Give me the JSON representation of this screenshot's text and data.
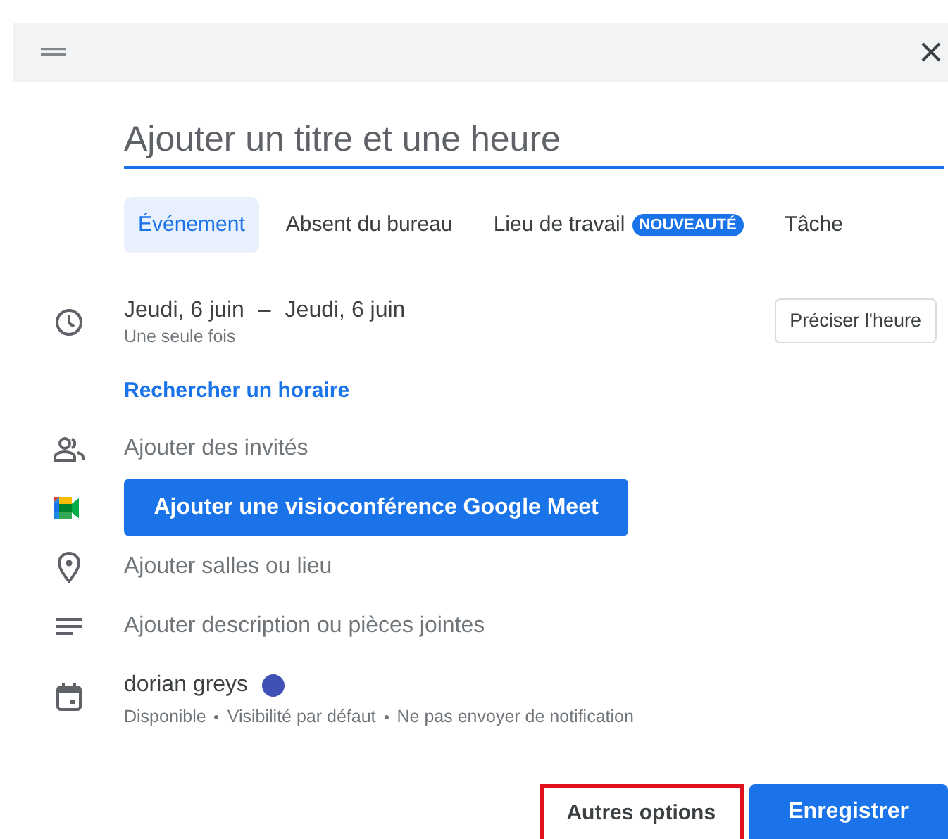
{
  "title_field": {
    "placeholder": "Ajouter un titre et une heure"
  },
  "tabs": [
    {
      "label": "Événement",
      "selected": true
    },
    {
      "label": "Absent du bureau",
      "selected": false
    },
    {
      "label": "Lieu de travail",
      "selected": false,
      "badge": "NOUVEAUTÉ"
    },
    {
      "label": "Tâche",
      "selected": false
    }
  ],
  "date": {
    "start": "Jeudi, 6 juin",
    "separator": "–",
    "end": "Jeudi, 6 juin",
    "recurrence": "Une seule fois",
    "time_button": "Préciser l'heure"
  },
  "find_time_link": "Rechercher un horaire",
  "guests": "Ajouter des invités",
  "meet_button": "Ajouter une visioconférence Google Meet",
  "location": "Ajouter salles ou lieu",
  "description": "Ajouter description ou pièces jointes",
  "calendar": {
    "name": "dorian greys",
    "color": "#3f51b5",
    "details": [
      "Disponible",
      "Visibilité par défaut",
      "Ne pas envoyer de notification"
    ]
  },
  "footer": [
    {
      "label": "Autres options",
      "kind": "text",
      "highlighted": true
    },
    {
      "label": "Enregistrer",
      "kind": "primary",
      "highlighted": false
    }
  ]
}
